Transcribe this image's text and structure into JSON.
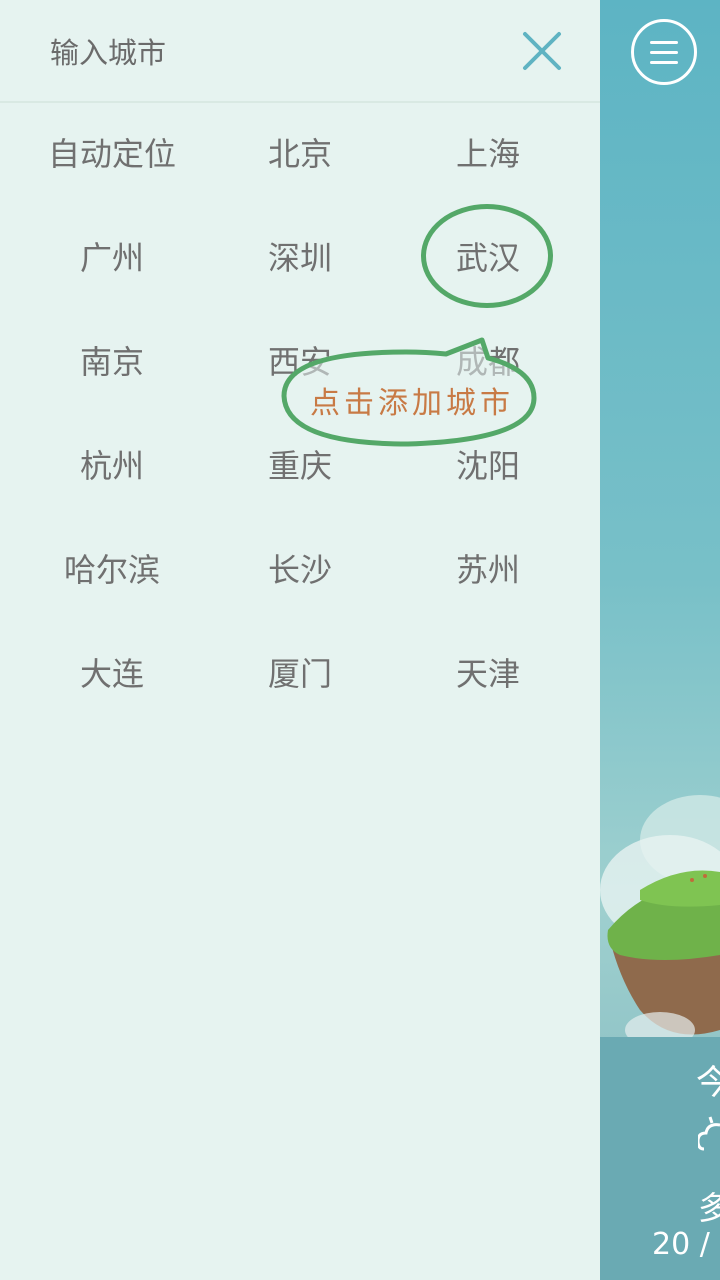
{
  "search": {
    "placeholder": "输入城市"
  },
  "cities": [
    [
      "自动定位",
      "北京",
      "上海"
    ],
    [
      "广州",
      "深圳",
      "武汉"
    ],
    [
      "南京",
      "西安",
      "成都"
    ],
    [
      "杭州",
      "重庆",
      "沈阳"
    ],
    [
      "哈尔滨",
      "长沙",
      "苏州"
    ],
    [
      "大连",
      "厦门",
      "天津"
    ]
  ],
  "annotation": {
    "text": "点击添加城市",
    "highlighted_city": "武汉"
  },
  "peek": {
    "text_top": "今",
    "text_mid": "多",
    "temp": "20 /"
  },
  "colors": {
    "drawer_bg": "#e6f3f0",
    "accent": "#5fb3c2",
    "annotation_green": "#54a868",
    "annotation_text": "#c87a45"
  },
  "icons": {
    "menu": "hamburger-menu-icon",
    "close": "close-icon",
    "weather": "cloudy-weather-icon"
  }
}
